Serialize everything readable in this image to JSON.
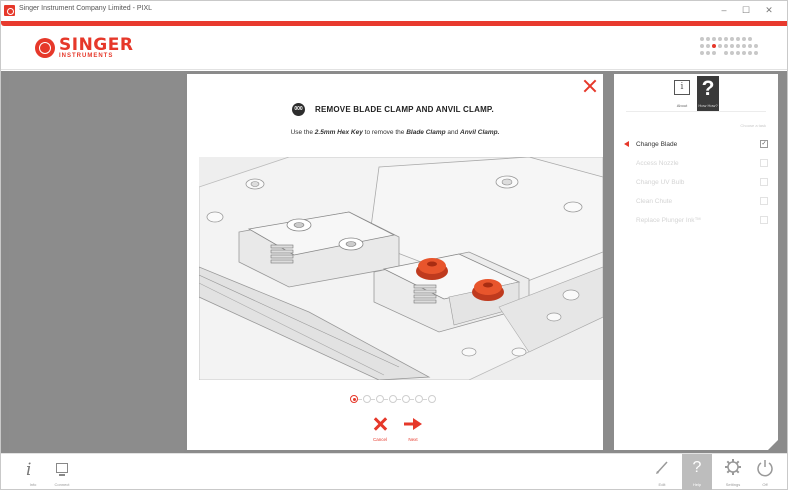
{
  "window": {
    "title": "Singer Instrument Company Limited - PIXL",
    "minimize_glyph": "–",
    "maximize_glyph": "☐",
    "close_glyph": "✕"
  },
  "header": {
    "brand": "SINGER",
    "brand_sub": "INSTRUMENTS",
    "menu_icon": "dot-matrix-icon"
  },
  "dialog": {
    "step_badge": "000",
    "title": "REMOVE BLADE CLAMP AND ANVIL CLAMP.",
    "instruction_pre": "Use the ",
    "instruction_tool": "2.5mm Hex Key",
    "instruction_mid": " to remove the ",
    "instruction_part1": "Blade Clamp",
    "instruction_and": " and ",
    "instruction_part2": "Anvil Clamp.",
    "pager": {
      "total": 7,
      "current": 1
    },
    "cancel_label": "Cancel",
    "next_label": "Next"
  },
  "right_panel": {
    "about_label": "About",
    "howto_label": "How How?",
    "hint": "Choose a task",
    "items": [
      {
        "label": "Change Blade",
        "active": true,
        "checked": true,
        "check_mark": "✓"
      },
      {
        "label": "Access Nozzle",
        "active": false,
        "checked": false,
        "check_mark": ""
      },
      {
        "label": "Change UV Bulb",
        "active": false,
        "checked": false,
        "check_mark": ""
      },
      {
        "label": "Clean Chute",
        "active": false,
        "checked": false,
        "check_mark": ""
      },
      {
        "label": "Replace Plunger Ink™",
        "active": false,
        "checked": false,
        "check_mark": ""
      }
    ]
  },
  "bottombar": {
    "info_label": "Info",
    "connect_label": "Connect",
    "edit_label": "Edit",
    "help_label": "Help",
    "settings_label": "Settings",
    "off_label": "Off"
  },
  "colors": {
    "accent": "#e6382a",
    "dark": "#2d2d2d",
    "backdrop": "#8b8b8b"
  }
}
